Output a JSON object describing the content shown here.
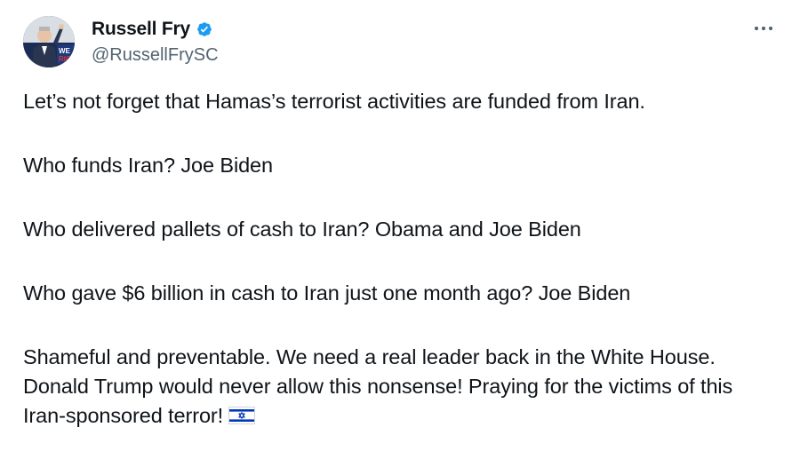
{
  "author": {
    "display_name": "Russell Fry",
    "handle": "@RussellFrySC",
    "verified": true,
    "verified_color": "#1d9bf0",
    "avatar_text": "WE RIC"
  },
  "menu": {
    "more_label": "More"
  },
  "tweet": {
    "paragraphs": [
      "Let’s not forget that Hamas’s terrorist activities are funded from Iran.",
      "Who funds Iran? Joe Biden",
      "Who delivered pallets of cash to Iran? Obama and Joe Biden",
      "Who gave $6 billion in cash to Iran just one month ago? Joe Biden",
      "Shameful and preventable. We need a real leader back in the White House. Donald Trump would never allow this nonsense! Praying for the victims of this Iran-sponsored terror!"
    ],
    "trailing_emoji": "israel-flag-emoji"
  },
  "colors": {
    "text": "#0f1419",
    "secondary_text": "#536471",
    "flag_blue": "#0038b8"
  }
}
